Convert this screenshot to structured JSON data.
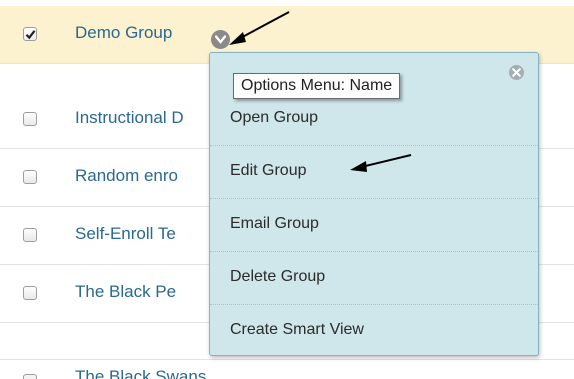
{
  "rows": [
    {
      "name": "Demo Group",
      "checked": true
    },
    {
      "name": "Instructional D",
      "checked": false
    },
    {
      "name": "Random enro",
      "checked": false
    },
    {
      "name": "Self-Enroll Te",
      "checked": false
    },
    {
      "name": "The Black Pe",
      "checked": false
    },
    {
      "name": "The Black Swans",
      "checked": false
    }
  ],
  "options_trigger_icon": "chevron-down-icon",
  "menu": {
    "close_icon": "close-icon",
    "items": [
      {
        "label": "Open Group"
      },
      {
        "label": "Edit Group"
      },
      {
        "label": "Email Group"
      },
      {
        "label": "Delete Group"
      },
      {
        "label": "Create Smart View"
      }
    ]
  },
  "tooltip": {
    "text": "Options Menu: Name"
  },
  "colors": {
    "selected_row_bg": "#fcf2cf",
    "menu_bg": "#cfe6ea",
    "link_text": "#2a6990"
  }
}
